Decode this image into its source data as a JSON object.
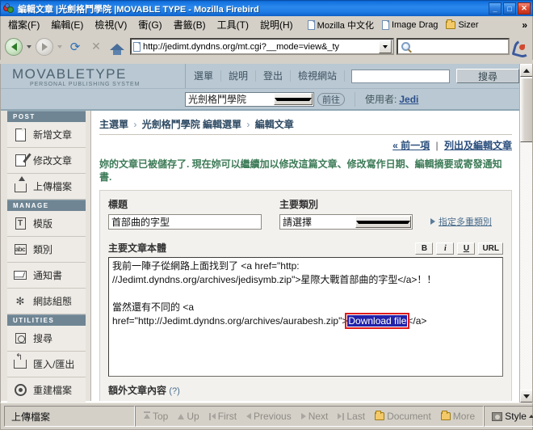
{
  "window": {
    "title": "編輯文章 |光劍格鬥學院 |MOVABLE TYPE - Mozilla Firebird",
    "minimize": "_",
    "maximize": "□",
    "close": "✕"
  },
  "menubar": {
    "items": [
      "檔案(F)",
      "編輯(E)",
      "檢視(V)",
      "衝(G)",
      "書籤(B)",
      "工具(T)",
      "說明(H)"
    ],
    "bookmarks": [
      {
        "label": "Mozilla 中文化",
        "icon": "document-icon"
      },
      {
        "label": "Image Drag",
        "icon": "document-icon"
      },
      {
        "label": "Sizer",
        "icon": "folder-icon"
      }
    ],
    "overflow": "»"
  },
  "navbar": {
    "back_icon": "back-arrow-icon",
    "forward_icon": "forward-arrow-icon",
    "reload_icon": "reload-icon",
    "stop_icon": "stop-icon",
    "home_icon": "home-icon",
    "url": "http://jedimt.dyndns.org/mt.cgi?__mode=view&_ty",
    "search_placeholder": "",
    "search_value": "",
    "search_icon": "magnifier-icon",
    "brand_icon": "firebird-logo-icon"
  },
  "mt": {
    "logo_main": "MOVABLETYPE",
    "logo_sub": "PERSONAL PUBLISHING SYSTEM",
    "nav": [
      "選單",
      "說明",
      "登出",
      "檢視網站"
    ],
    "search_value": "",
    "search_button": "搜尋",
    "blog_selected": "光劍格鬥學院",
    "go_button": "前往",
    "user_label": "使用者:",
    "user_name": "Jedi"
  },
  "sidebar": {
    "sections": [
      {
        "title": "POST",
        "items": [
          {
            "label": "新增文章",
            "icon": "page-icon"
          },
          {
            "label": "修改文章",
            "icon": "pencil-edit-icon"
          },
          {
            "label": "上傳檔案",
            "icon": "upload-folder-icon"
          }
        ]
      },
      {
        "title": "MANAGE",
        "items": [
          {
            "label": "模版",
            "icon": "template-t-icon"
          },
          {
            "label": "類別",
            "icon": "abc-icon"
          },
          {
            "label": "通知書",
            "icon": "envelope-icon"
          },
          {
            "label": "網誌組態",
            "icon": "tools-icon"
          }
        ]
      },
      {
        "title": "UTILITIES",
        "items": [
          {
            "label": "搜尋",
            "icon": "search-icon"
          },
          {
            "label": "匯入/匯出",
            "icon": "import-export-icon"
          },
          {
            "label": "重建檔案",
            "icon": "rebuild-target-icon"
          }
        ]
      }
    ]
  },
  "content": {
    "breadcrumb": {
      "root": "主選單",
      "middle": "光劍格鬥學院 編輯選單",
      "current": "編輯文章",
      "separator": "›"
    },
    "quick_links": {
      "prev": "« 前一項",
      "divider": "|",
      "list": "列出及編輯文章"
    },
    "notice": "妳的文章已被儲存了. 現在妳可以繼續加以修改這篇文章、修改寫作日期、編輯摘要或寄發通知書.",
    "fields": {
      "title_label": "標題",
      "title_value": "首部曲的字型",
      "category_label": "主要類別",
      "category_value": "請選擇",
      "multi_category_link": "指定多重類別"
    },
    "body": {
      "label": "主要文章本體",
      "format_buttons": [
        "B",
        "i",
        "U",
        "URL"
      ],
      "line1": "我前一陣子從網路上面找到了 <a href=\"http:",
      "line2": "//Jedimt.dyndns.org/archives/jedisymb.zip\">星際大戰首部曲的字型</a>！！",
      "line3": "當然還有不同的 <a",
      "line4_pre": "href=\"http://Jedimt.dyndns.org/archives/aurabesh.zip\">",
      "line4_selected": "Download file",
      "line4_post": "</a>"
    },
    "extra_label": "額外文章內容",
    "extra_hint": "(?)"
  },
  "statusbar": {
    "status_text": "上傳檔案",
    "nav_items": [
      {
        "label": "Top",
        "icon": "top-arrow-icon"
      },
      {
        "label": "Up",
        "icon": "up-arrow-icon"
      },
      {
        "label": "First",
        "icon": "first-arrow-icon"
      },
      {
        "label": "Previous",
        "icon": "previous-arrow-icon"
      },
      {
        "label": "Next",
        "icon": "next-arrow-icon"
      },
      {
        "label": "Last",
        "icon": "last-arrow-icon"
      },
      {
        "label": "Document",
        "icon": "folder-icon"
      },
      {
        "label": "More",
        "icon": "folder-icon"
      }
    ],
    "style_label": "Style",
    "style_caret": "▲"
  },
  "colors": {
    "titlebar": "#1573e0",
    "mt_header": "#b9c8d2",
    "section_header": "#6f8594",
    "notice_green": "#3d7b57",
    "selection_blue": "#2222aa",
    "annotation_red": "#e01b1b",
    "link_blue": "#2b4f7d"
  }
}
